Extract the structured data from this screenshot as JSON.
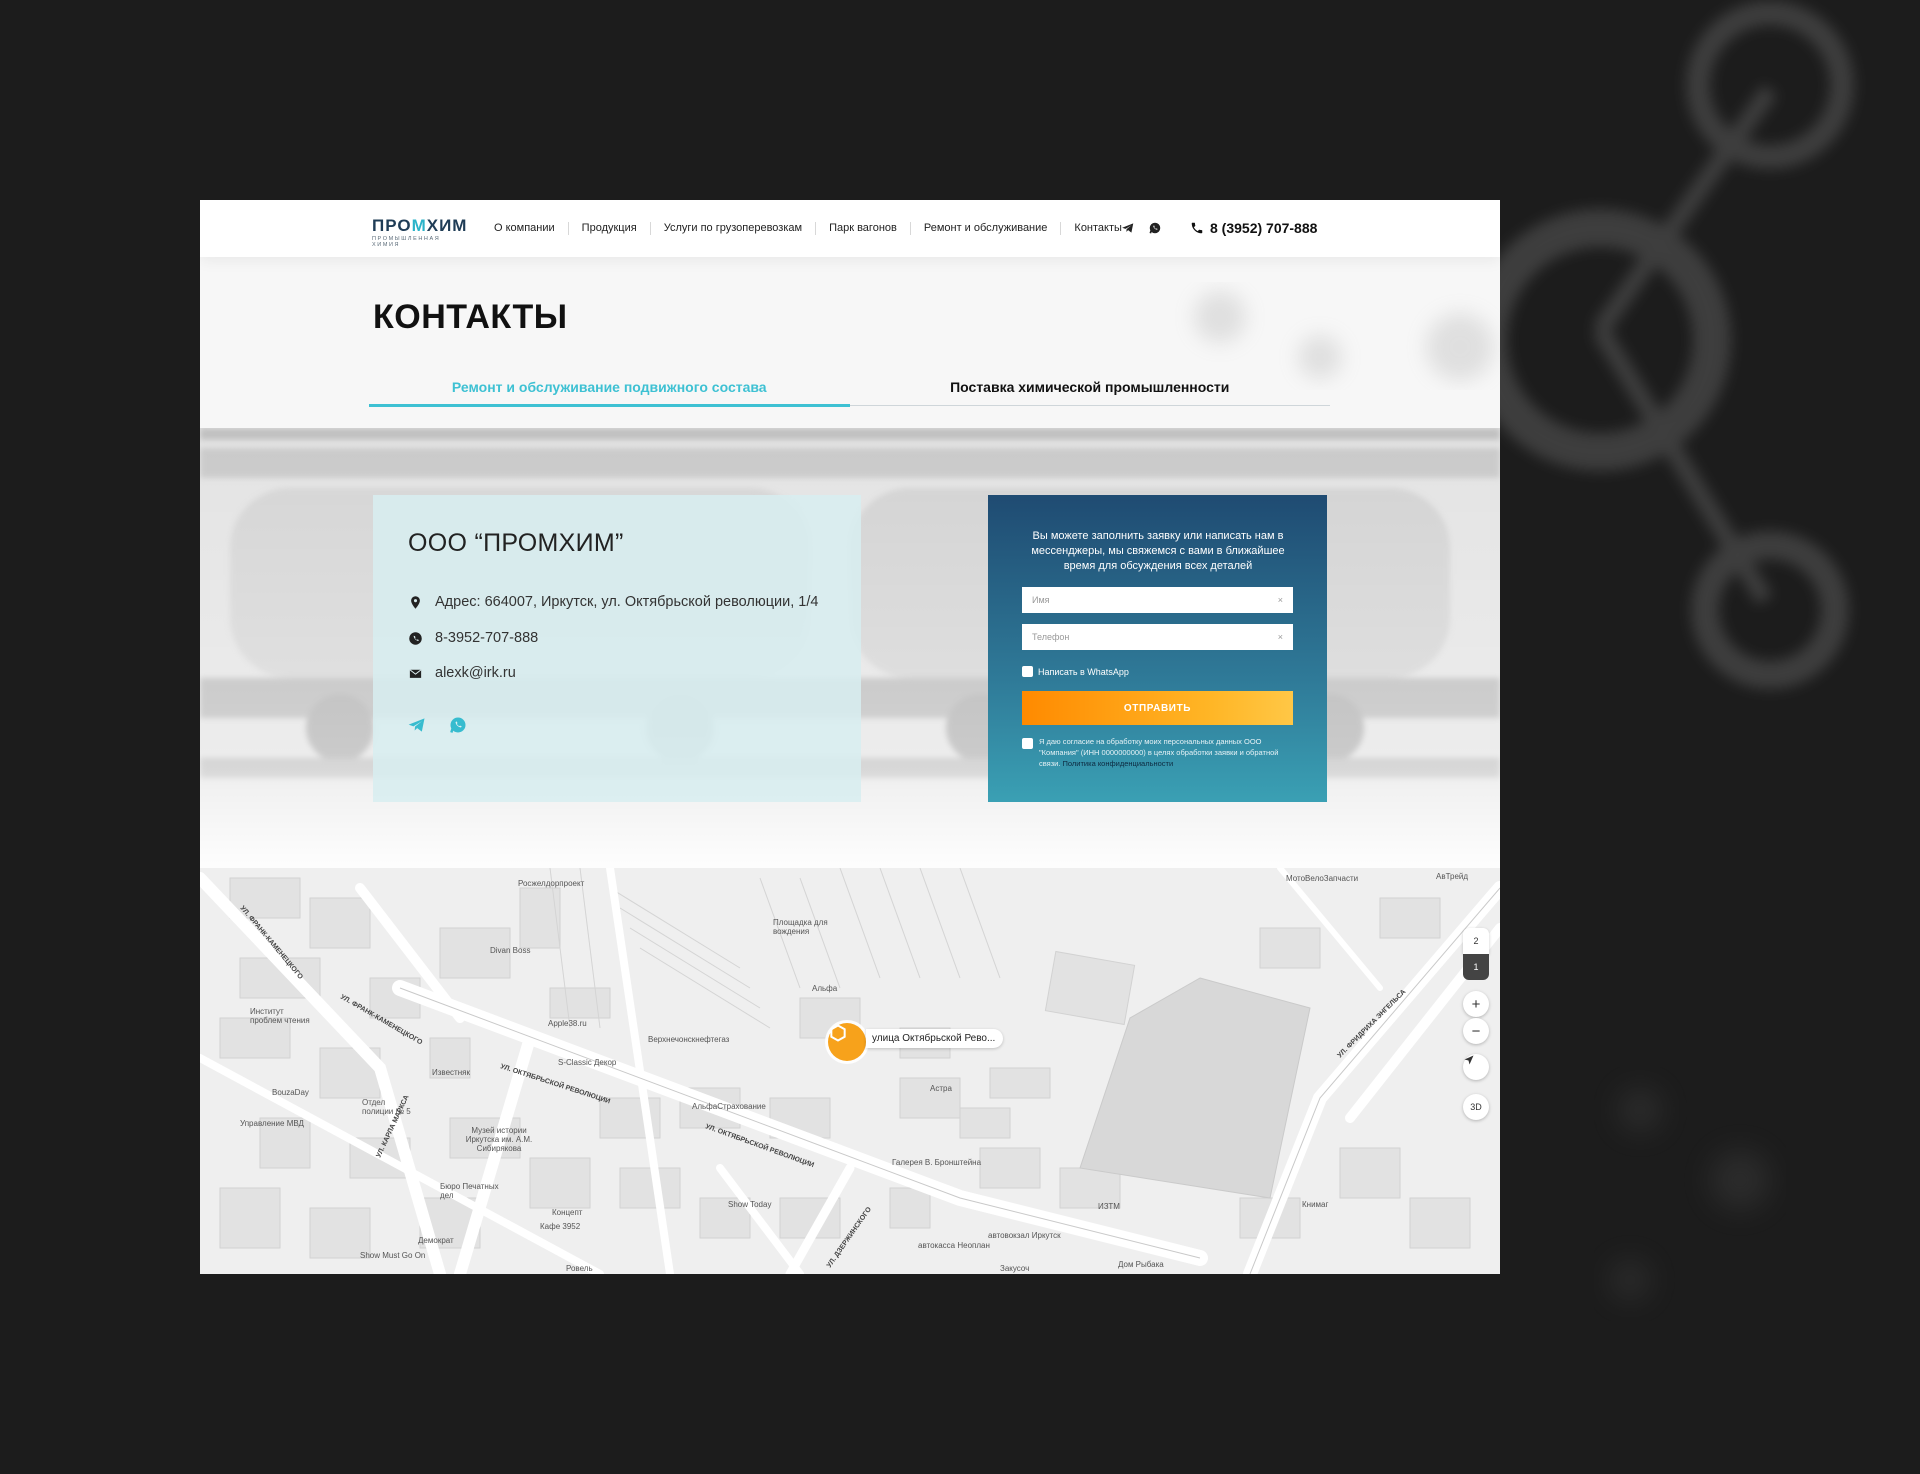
{
  "header": {
    "logo_main_a": "ПРО",
    "logo_main_b": "М",
    "logo_main_c": "ХИМ",
    "logo_sub": "ПРОМЫШЛЕННАЯ ХИМИЯ",
    "nav": [
      "О компании",
      "Продукция",
      "Услуги по грузоперевозкам",
      "Парк вагонов",
      "Ремонт и обслуживание",
      "Контакты"
    ],
    "phone": "8 (3952) 707-888",
    "icons": [
      "telegram-icon",
      "whatsapp-icon",
      "phone-icon"
    ]
  },
  "page": {
    "title": "КОНТАКТЫ",
    "tabs": [
      "Ремонт и обслуживание подвижного состава",
      "Поставка химической промышленности"
    ]
  },
  "contact": {
    "company": "ООО “ПРОМХИМ”",
    "address": "Адрес: 664007, Иркутск, ул. Октябрьской революции, 1/4",
    "phone": "8-3952-707-888",
    "email": "alexk@irk.ru"
  },
  "form": {
    "intro": "Вы можете заполнить заявку или написать нам в мессенджеры, мы свяжемся с вами в ближайшее время для обсуждения всех деталей",
    "name_placeholder": "Имя",
    "phone_placeholder": "Телефон",
    "required_mark": "×",
    "whatsapp_label": "Написать в WhatsApp",
    "submit": "ОТПРАВИТЬ",
    "consent": "Я даю согласие на обработку моих персональных данных ООО \"Компания\" (ИНН 0000000000) в целях обработки заявки и обратной связи.",
    "consent_link": "Политика конфиденциальности"
  },
  "map": {
    "pin_label": "улица Октябрьской Рево...",
    "floors": [
      "2",
      "1"
    ],
    "zoom_in": "+",
    "zoom_out": "−",
    "mode_3d": "3D",
    "labels": {
      "rzd": "Росжелдорпроект",
      "divan": "Divan Boss",
      "parking": "Площадка для вождения",
      "alfa": "Альфа",
      "apple": "Apple38.ru",
      "vnng": "Верхнечонскнефтегаз",
      "classic": "S-Classic Декор",
      "izvest": "Известняк",
      "alfastrah": "АльфаСтрахование",
      "astra": "Астра",
      "institute": "Институт проблем чтения",
      "bouza": "BouzaDay",
      "otdel": "Отдел полиции № 5",
      "mvd": "Управление МВД",
      "muzey": "Музей истории Иркутска им. А.М. Сибирякова",
      "gallery": "Галерея В. Бронштейна",
      "pechat": "Бюро Печатных дел",
      "koncept": "Концепт",
      "demokrat": "Демократ",
      "kafe": "Кафе 3952",
      "show_today": "Show Today",
      "show_must": "Show Must Go On",
      "avtokassa": "автокасса Неоплан",
      "avtovokzal": "автовокзал Иркутск",
      "iztm": "ИЗТМ",
      "dom_rybaka": "Дом Рыбака",
      "zakusochnaya": "Закусоч",
      "rovel": "Ровель",
      "knimag": "Книмаг",
      "motovelo": "МотоВелоЗапчасти",
      "avtreid": "АвТрейд",
      "street_okt": "УЛ. ОКТЯБРЬСКОЙ РЕВОЛЮЦИИ",
      "street_okt2": "УЛ. ОКТЯБРЬСКОЙ РЕВОЛЮЦИИ",
      "street_fk": "УЛ. ФРАНК-КАМЕНЕЦКОГО",
      "street_fk2": "УЛ. ФРАНК-КАМЕНЕЦКОГО",
      "street_engels": "УЛ. ФРИДРИХА ЭНГЕЛЬСА",
      "street_karl": "УЛ. КАРЛА МАРКСА",
      "street_dzerzh": "УЛ. ДЗЕРЖИНСКОГО"
    }
  }
}
